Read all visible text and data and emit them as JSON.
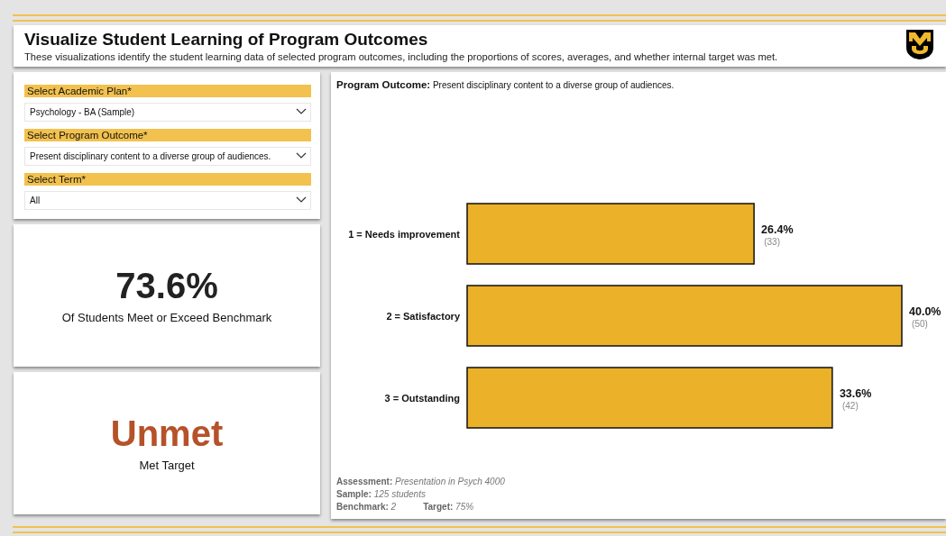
{
  "header": {
    "title": "Visualize Student Learning of Program Outcomes",
    "subtitle": "These visualizations identify the student learning data of selected program outcomes, including the proportions of scores, averages, and whether internal target was met."
  },
  "filters": [
    {
      "label": "Select Academic Plan*",
      "value": "Psychology - BA (Sample)"
    },
    {
      "label": "Select Program Outcome*",
      "value": "Present disciplinary content to a diverse group of audiences."
    },
    {
      "label": "Select Term*",
      "value": "All"
    }
  ],
  "benchmark_card": {
    "value": "73.6%",
    "caption": "Of Students Meet or Exceed Benchmark"
  },
  "target_card": {
    "value": "Unmet",
    "met": false,
    "caption": "Met Target"
  },
  "outcome_panel": {
    "heading": "**Program Outcome:** Present disciplinary content to a diverse group of audiences.",
    "chart_data": {
      "type": "bar",
      "orientation": "horizontal",
      "categories": [
        "1 = Needs improvement",
        "2 = Satisfactory",
        "3 = Outstanding"
      ],
      "values": [
        26.4,
        40.0,
        33.6
      ],
      "value_labels": [
        "26.4%",
        "40.0%",
        "33.6%"
      ],
      "annotations": [
        "(33)",
        "(50)",
        "(42)"
      ]
    },
    "notes": [
      "**Assessment:** *Presentation in Psych 4000*",
      "**Sample:** *125 students*",
      "**Benchmark:** *2*",
      "**Target:** *75%*"
    ]
  }
}
